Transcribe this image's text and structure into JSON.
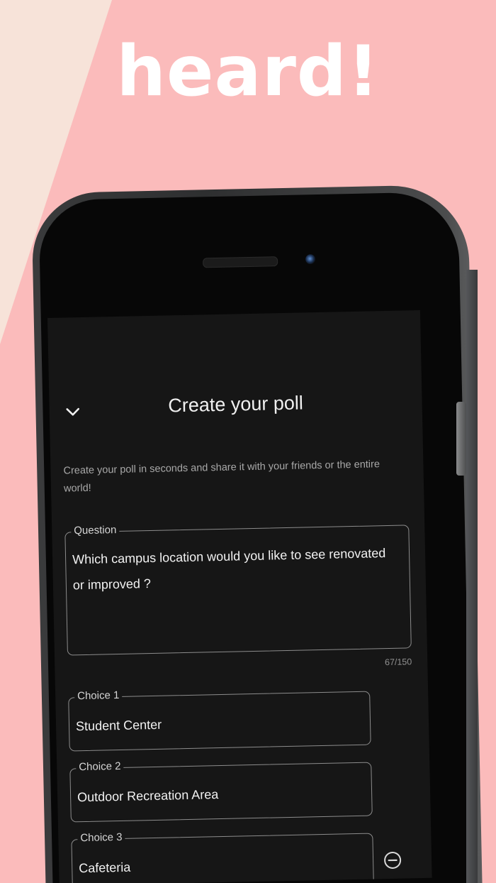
{
  "headline": "heard!",
  "screen": {
    "title": "Create your poll",
    "subtitle": "Create your poll in seconds and share it with your friends or the entire world!",
    "question": {
      "label": "Question",
      "value": "Which campus location would you like to see renovated or improved ?",
      "counter": "67/150"
    },
    "choices": [
      {
        "label": "Choice 1",
        "value": "Student Center"
      },
      {
        "label": "Choice 2",
        "value": "Outdoor Recreation Area"
      },
      {
        "label": "Choice 3",
        "value": "Cafeteria"
      }
    ]
  },
  "icons": {
    "back": "chevron-down-icon",
    "remove": "minus-circle-icon"
  },
  "colors": {
    "background_pink": "#fbbbbb",
    "background_cream": "#f7e3d9",
    "screen_bg": "#161616",
    "field_border": "#8c8c8c"
  }
}
